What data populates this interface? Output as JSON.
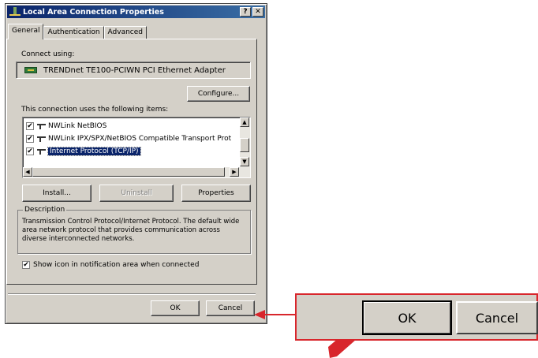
{
  "window": {
    "title": "Local Area Connection Properties",
    "help_button": "?",
    "close_button": "✕"
  },
  "tabs": [
    {
      "label": "General",
      "active": true
    },
    {
      "label": "Authentication",
      "active": false
    },
    {
      "label": "Advanced",
      "active": false
    }
  ],
  "connect_using": {
    "label": "Connect using:",
    "adapter": "TRENDnet TE100-PCIWN PCI Ethernet Adapter",
    "configure_button": "Configure..."
  },
  "components": {
    "label": "This connection uses the following items:",
    "items": [
      {
        "label": "NWLink NetBIOS",
        "checked": true,
        "selected": false
      },
      {
        "label": "NWLink IPX/SPX/NetBIOS Compatible Transport Prot",
        "checked": true,
        "selected": false
      },
      {
        "label": "Internet Protocol (TCP/IP)",
        "checked": true,
        "selected": true
      }
    ]
  },
  "actions": {
    "install": "Install...",
    "uninstall": "Uninstall",
    "properties": "Properties"
  },
  "description": {
    "legend": "Description",
    "text": "Transmission Control Protocol/Internet Protocol. The default wide area network protocol that provides communication across diverse interconnected networks."
  },
  "show_icon": {
    "label": "Show icon in notification area when connected",
    "checked": true
  },
  "footer": {
    "ok": "OK",
    "cancel": "Cancel"
  },
  "zoom": {
    "ok": "OK",
    "cancel": "Cancel"
  },
  "colors": {
    "callout": "#d8262c",
    "titlebar": "#0a246a",
    "dialog": "#d4d0c8"
  }
}
